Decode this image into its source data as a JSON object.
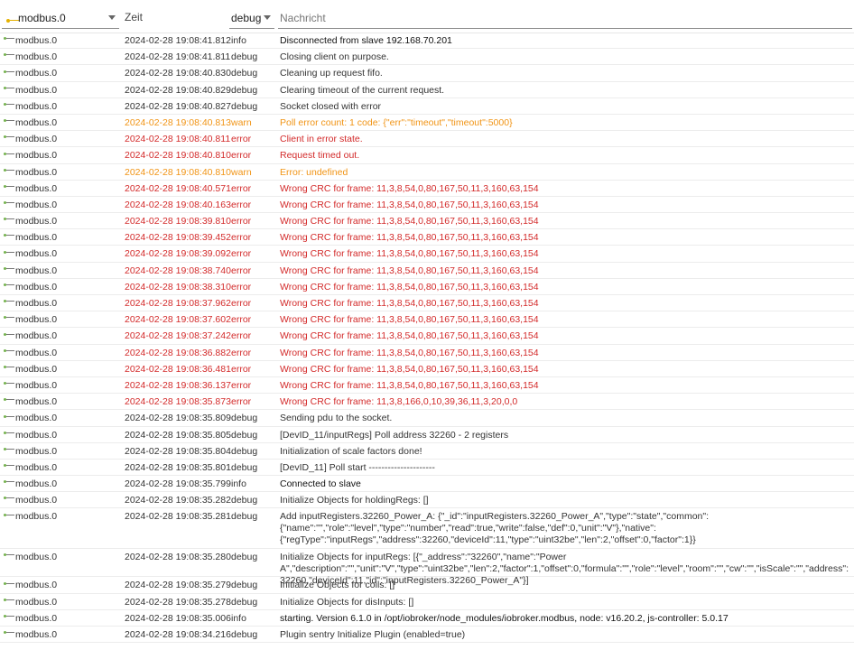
{
  "header": {
    "source_filter": "modbus.0",
    "time_label": "Zeit",
    "severity_filter": "debug",
    "message_placeholder": "Nachricht"
  },
  "rows": [
    {
      "src": "modbus.0",
      "time": "2024-02-28 19:08:41.812",
      "sev": "info",
      "msg": "Disconnected from slave 192.168.70.201",
      "lines": 1
    },
    {
      "src": "modbus.0",
      "time": "2024-02-28 19:08:41.811",
      "sev": "debug",
      "msg": "Closing client on purpose.",
      "lines": 1
    },
    {
      "src": "modbus.0",
      "time": "2024-02-28 19:08:40.830",
      "sev": "debug",
      "msg": "Cleaning up request fifo.",
      "lines": 1
    },
    {
      "src": "modbus.0",
      "time": "2024-02-28 19:08:40.829",
      "sev": "debug",
      "msg": "Clearing timeout of the current request.",
      "lines": 1
    },
    {
      "src": "modbus.0",
      "time": "2024-02-28 19:08:40.827",
      "sev": "debug",
      "msg": "Socket closed with error",
      "lines": 1
    },
    {
      "src": "modbus.0",
      "time": "2024-02-28 19:08:40.813",
      "sev": "warn",
      "msg": "Poll error count: 1 code: {\"err\":\"timeout\",\"timeout\":5000}",
      "lines": 1
    },
    {
      "src": "modbus.0",
      "time": "2024-02-28 19:08:40.811",
      "sev": "error",
      "msg": "Client in error state.",
      "lines": 1
    },
    {
      "src": "modbus.0",
      "time": "2024-02-28 19:08:40.810",
      "sev": "error",
      "msg": "Request timed out.",
      "lines": 1
    },
    {
      "src": "modbus.0",
      "time": "2024-02-28 19:08:40.810",
      "sev": "warn",
      "msg": "Error: undefined",
      "lines": 1
    },
    {
      "src": "modbus.0",
      "time": "2024-02-28 19:08:40.571",
      "sev": "error",
      "msg": "Wrong CRC for frame: 11,3,8,54,0,80,167,50,11,3,160,63,154",
      "lines": 1
    },
    {
      "src": "modbus.0",
      "time": "2024-02-28 19:08:40.163",
      "sev": "error",
      "msg": "Wrong CRC for frame: 11,3,8,54,0,80,167,50,11,3,160,63,154",
      "lines": 1
    },
    {
      "src": "modbus.0",
      "time": "2024-02-28 19:08:39.810",
      "sev": "error",
      "msg": "Wrong CRC for frame: 11,3,8,54,0,80,167,50,11,3,160,63,154",
      "lines": 1
    },
    {
      "src": "modbus.0",
      "time": "2024-02-28 19:08:39.452",
      "sev": "error",
      "msg": "Wrong CRC for frame: 11,3,8,54,0,80,167,50,11,3,160,63,154",
      "lines": 1
    },
    {
      "src": "modbus.0",
      "time": "2024-02-28 19:08:39.092",
      "sev": "error",
      "msg": "Wrong CRC for frame: 11,3,8,54,0,80,167,50,11,3,160,63,154",
      "lines": 1
    },
    {
      "src": "modbus.0",
      "time": "2024-02-28 19:08:38.740",
      "sev": "error",
      "msg": "Wrong CRC for frame: 11,3,8,54,0,80,167,50,11,3,160,63,154",
      "lines": 1
    },
    {
      "src": "modbus.0",
      "time": "2024-02-28 19:08:38.310",
      "sev": "error",
      "msg": "Wrong CRC for frame: 11,3,8,54,0,80,167,50,11,3,160,63,154",
      "lines": 1
    },
    {
      "src": "modbus.0",
      "time": "2024-02-28 19:08:37.962",
      "sev": "error",
      "msg": "Wrong CRC for frame: 11,3,8,54,0,80,167,50,11,3,160,63,154",
      "lines": 1
    },
    {
      "src": "modbus.0",
      "time": "2024-02-28 19:08:37.602",
      "sev": "error",
      "msg": "Wrong CRC for frame: 11,3,8,54,0,80,167,50,11,3,160,63,154",
      "lines": 1
    },
    {
      "src": "modbus.0",
      "time": "2024-02-28 19:08:37.242",
      "sev": "error",
      "msg": "Wrong CRC for frame: 11,3,8,54,0,80,167,50,11,3,160,63,154",
      "lines": 1
    },
    {
      "src": "modbus.0",
      "time": "2024-02-28 19:08:36.882",
      "sev": "error",
      "msg": "Wrong CRC for frame: 11,3,8,54,0,80,167,50,11,3,160,63,154",
      "lines": 1
    },
    {
      "src": "modbus.0",
      "time": "2024-02-28 19:08:36.481",
      "sev": "error",
      "msg": "Wrong CRC for frame: 11,3,8,54,0,80,167,50,11,3,160,63,154",
      "lines": 1
    },
    {
      "src": "modbus.0",
      "time": "2024-02-28 19:08:36.137",
      "sev": "error",
      "msg": "Wrong CRC for frame: 11,3,8,54,0,80,167,50,11,3,160,63,154",
      "lines": 1
    },
    {
      "src": "modbus.0",
      "time": "2024-02-28 19:08:35.873",
      "sev": "error",
      "msg": "Wrong CRC for frame: 11,3,8,166,0,10,39,36,11,3,20,0,0",
      "lines": 1
    },
    {
      "src": "modbus.0",
      "time": "2024-02-28 19:08:35.809",
      "sev": "debug",
      "msg": "Sending pdu to the socket.",
      "lines": 1
    },
    {
      "src": "modbus.0",
      "time": "2024-02-28 19:08:35.805",
      "sev": "debug",
      "msg": "[DevID_11/inputRegs] Poll address 32260 - 2 registers",
      "lines": 1
    },
    {
      "src": "modbus.0",
      "time": "2024-02-28 19:08:35.804",
      "sev": "debug",
      "msg": "Initialization of scale factors done!",
      "lines": 1
    },
    {
      "src": "modbus.0",
      "time": "2024-02-28 19:08:35.801",
      "sev": "debug",
      "msg": "[DevID_11] Poll start ---------------------",
      "lines": 1
    },
    {
      "src": "modbus.0",
      "time": "2024-02-28 19:08:35.799",
      "sev": "info",
      "msg": "Connected to slave",
      "lines": 1
    },
    {
      "src": "modbus.0",
      "time": "2024-02-28 19:08:35.282",
      "sev": "debug",
      "msg": "Initialize Objects for holdingRegs: []",
      "lines": 1
    },
    {
      "src": "modbus.0",
      "time": "2024-02-28 19:08:35.281",
      "sev": "debug",
      "msg": "Add inputRegisters.32260_Power_A: {\"_id\":\"inputRegisters.32260_Power_A\",\"type\":\"state\",\"common\":{\"name\":\"\",\"role\":\"level\",\"type\":\"number\",\"read\":true,\"write\":false,\"def\":0,\"unit\":\"V\"},\"native\":{\"regType\":\"inputRegs\",\"address\":32260,\"deviceId\":11,\"type\":\"uint32be\",\"len\":2,\"offset\":0,\"factor\":1}}",
      "lines": 3
    },
    {
      "src": "modbus.0",
      "time": "2024-02-28 19:08:35.280",
      "sev": "debug",
      "msg": "Initialize Objects for inputRegs: [{\"_address\":\"32260\",\"name\":\"Power A\",\"description\":\"\",\"unit\":\"V\",\"type\":\"uint32be\",\"len\":2,\"factor\":1,\"offset\":0,\"formula\":\"\",\"role\":\"level\",\"room\":\"\",\"cw\":\"\",\"isScale\":\"\",\"address\":32260,\"deviceId\":11,\"id\":\"inputRegisters.32260_Power_A\"}]",
      "lines": 2
    },
    {
      "src": "modbus.0",
      "time": "2024-02-28 19:08:35.279",
      "sev": "debug",
      "msg": "Initialize Objects for coils: []",
      "lines": 1
    },
    {
      "src": "modbus.0",
      "time": "2024-02-28 19:08:35.278",
      "sev": "debug",
      "msg": "Initialize Objects for disInputs: []",
      "lines": 1
    },
    {
      "src": "modbus.0",
      "time": "2024-02-28 19:08:35.006",
      "sev": "info",
      "msg": "starting. Version 6.1.0 in /opt/iobroker/node_modules/iobroker.modbus, node: v16.20.2, js-controller: 5.0.17",
      "lines": 1
    },
    {
      "src": "modbus.0",
      "time": "2024-02-28 19:08:34.216",
      "sev": "debug",
      "msg": "Plugin sentry Initialize Plugin (enabled=true)",
      "lines": 1
    }
  ]
}
